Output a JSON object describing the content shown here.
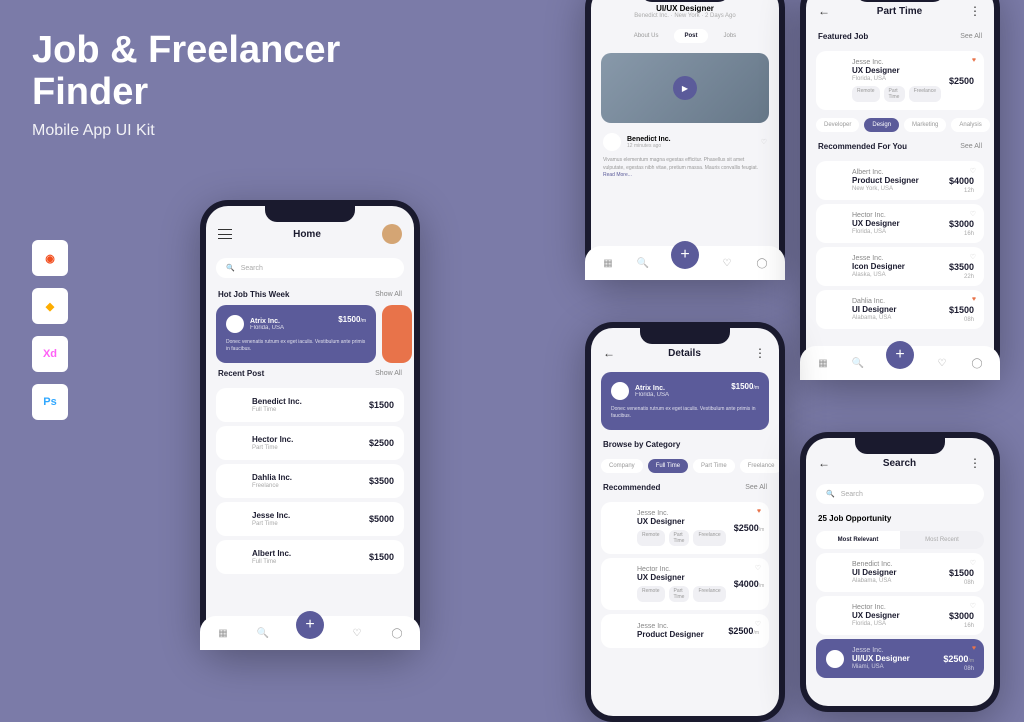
{
  "hero": {
    "title_line1": "Job & Freelancer",
    "title_line2": "Finder",
    "subtitle": "Mobile App UI Kit"
  },
  "tools": [
    "Figma",
    "Sketch",
    "Xd",
    "Ps"
  ],
  "common": {
    "show_all": "Show All",
    "see_all": "See All",
    "search_placeholder": "Search"
  },
  "home": {
    "title": "Home",
    "hot_title": "Hot Job This Week",
    "hot": {
      "company": "Atrix Inc.",
      "location": "Florida, USA",
      "price": "$1500",
      "unit": "/m",
      "desc": "Donec venenatis rutrum ex eget iaculis. Vestibulum ante primis in faucibus."
    },
    "recent_title": "Recent Post",
    "recent": [
      {
        "company": "Benedict Inc.",
        "type": "Full Time",
        "price": "$1500"
      },
      {
        "company": "Hector Inc.",
        "type": "Part Time",
        "price": "$2500"
      },
      {
        "company": "Dahlia Inc.",
        "type": "Freelance",
        "price": "$3500"
      },
      {
        "company": "Jesse Inc.",
        "type": "Part Time",
        "price": "$5000"
      },
      {
        "company": "Albert Inc.",
        "type": "Full Time",
        "price": "$1500"
      }
    ]
  },
  "profile": {
    "role": "UI/UX Designer",
    "company": "Benedict Inc.",
    "loc": "New York",
    "time": "2 Days Ago",
    "tabs": [
      "About Us",
      "Post",
      "Jobs"
    ],
    "post_company": "Benedict Inc.",
    "post_time": "12 minutes ago",
    "post_desc": "Vivamus elementum magna egestas efficitur. Phasellus sit amet vulputate, egestas nibh vitae, pretium massa. Mauris convallis feugiat.",
    "read_more": "Read More..."
  },
  "details": {
    "title": "Details",
    "hot": {
      "company": "Atrix Inc.",
      "location": "Florida, USA",
      "price": "$1500",
      "unit": "/m",
      "desc": "Donec venenatis rutrum ex eget iaculis. Vestibulum ante primis in faucibus."
    },
    "browse_title": "Browse by Category",
    "categories": [
      "Company",
      "Full Time",
      "Part Time",
      "Freelance"
    ],
    "rec_title": "Recommended",
    "recs": [
      {
        "company": "Jesse Inc.",
        "role": "UX Designer",
        "price": "$2500",
        "unit": "/m",
        "tags": [
          "Remote",
          "Part Time",
          "Freelance"
        ],
        "fav": true
      },
      {
        "company": "Hector Inc.",
        "role": "UX Designer",
        "price": "$4000",
        "unit": "/m",
        "tags": [
          "Remote",
          "Part Time",
          "Freelance"
        ],
        "fav": false
      },
      {
        "company": "Jesse Inc.",
        "role": "Product Designer",
        "price": "$2500",
        "unit": "/m"
      }
    ]
  },
  "parttime": {
    "title": "Part Time",
    "featured_title": "Featured Job",
    "featured": {
      "company": "Jesse Inc.",
      "role": "UX Designer",
      "loc": "Florida, USA",
      "price": "$2500",
      "tags": [
        "Remote",
        "Part Time",
        "Freelance"
      ],
      "fav": true
    },
    "filters": [
      "Developer",
      "Design",
      "Marketing",
      "Analysis"
    ],
    "rec_title": "Recommended For You",
    "recs": [
      {
        "company": "Albert Inc.",
        "role": "Product Designer",
        "loc": "New York, USA",
        "price": "$4000",
        "time": "12h"
      },
      {
        "company": "Hector Inc.",
        "role": "UX Designer",
        "loc": "Florida, USA",
        "price": "$3000",
        "time": "16h"
      },
      {
        "company": "Jesse Inc.",
        "role": "Icon Designer",
        "loc": "Alaska, USA",
        "price": "$3500",
        "time": "22h"
      },
      {
        "company": "Dahlia Inc.",
        "role": "UI Designer",
        "loc": "Alabama, USA",
        "price": "$1500",
        "time": "08h",
        "fav": true
      }
    ]
  },
  "search": {
    "title": "Search",
    "results": "25 Job Opportunity",
    "sorts": [
      "Most Relevant",
      "Most Recent"
    ],
    "items": [
      {
        "company": "Benedict Inc.",
        "role": "UI Designer",
        "loc": "Alabama, USA",
        "price": "$1500",
        "time": "08h"
      },
      {
        "company": "Hector Inc.",
        "role": "UX Designer",
        "loc": "Florida, USA",
        "price": "$3000",
        "time": "16h"
      },
      {
        "company": "Jesse Inc.",
        "role": "UI/UX Designer",
        "loc": "Miami, USA",
        "price": "$2500",
        "unit": "/m",
        "time": "08h",
        "selected": true,
        "fav": true
      }
    ]
  }
}
